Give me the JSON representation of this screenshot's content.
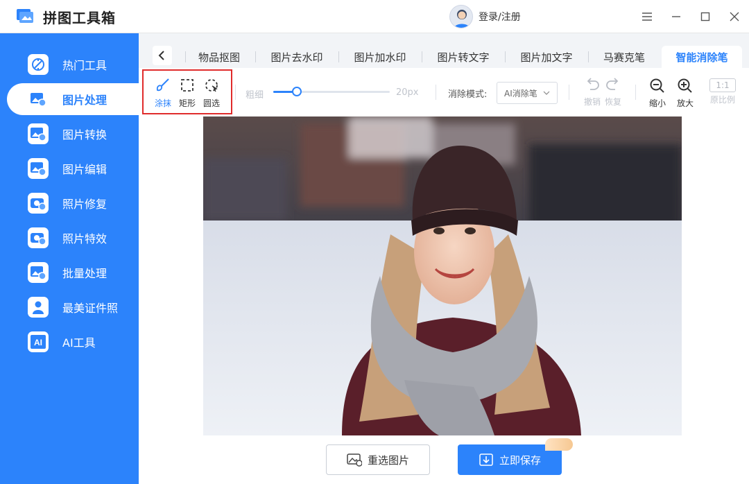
{
  "app": {
    "title": "拼图工具箱",
    "login_label": "登录/注册"
  },
  "window_controls": [
    "menu-icon",
    "minimize-icon",
    "maximize-icon",
    "close-icon"
  ],
  "sidebar": {
    "items": [
      {
        "label": "热门工具",
        "icon": "tools-icon"
      },
      {
        "label": "图片处理",
        "icon": "image-process-icon",
        "active": true
      },
      {
        "label": "图片转换",
        "icon": "image-convert-icon"
      },
      {
        "label": "图片编辑",
        "icon": "image-edit-icon"
      },
      {
        "label": "照片修复",
        "icon": "photo-repair-icon"
      },
      {
        "label": "照片特效",
        "icon": "photo-effects-icon"
      },
      {
        "label": "批量处理",
        "icon": "batch-icon"
      },
      {
        "label": "最美证件照",
        "icon": "id-photo-icon"
      },
      {
        "label": "AI工具",
        "icon": "ai-icon"
      }
    ]
  },
  "tabs": [
    {
      "label": "物品抠图"
    },
    {
      "label": "图片去水印"
    },
    {
      "label": "图片加水印"
    },
    {
      "label": "图片转文字"
    },
    {
      "label": "图片加文字"
    },
    {
      "label": "马赛克笔"
    },
    {
      "label": "智能消除笔",
      "active": true
    }
  ],
  "toolbar": {
    "tools": [
      {
        "label": "涂抹",
        "icon": "brush-icon",
        "active": true
      },
      {
        "label": "矩形",
        "icon": "rectangle-select-icon"
      },
      {
        "label": "圆选",
        "icon": "circle-select-icon"
      }
    ],
    "thickness_label": "粗细",
    "thickness_value": "20px",
    "thickness_fraction": 0.2,
    "mode_label": "消除模式:",
    "mode_value": "AI消除笔",
    "undo_label": "撤销",
    "redo_label": "恢复",
    "zoom_out_label": "缩小",
    "zoom_in_label": "放大",
    "ratio_box": "1:1",
    "original_label": "原比例"
  },
  "buttons": {
    "reselect": "重选图片",
    "save": "立即保存"
  },
  "colors": {
    "accent": "#2c83fb",
    "highlight": "#e02b2b"
  }
}
